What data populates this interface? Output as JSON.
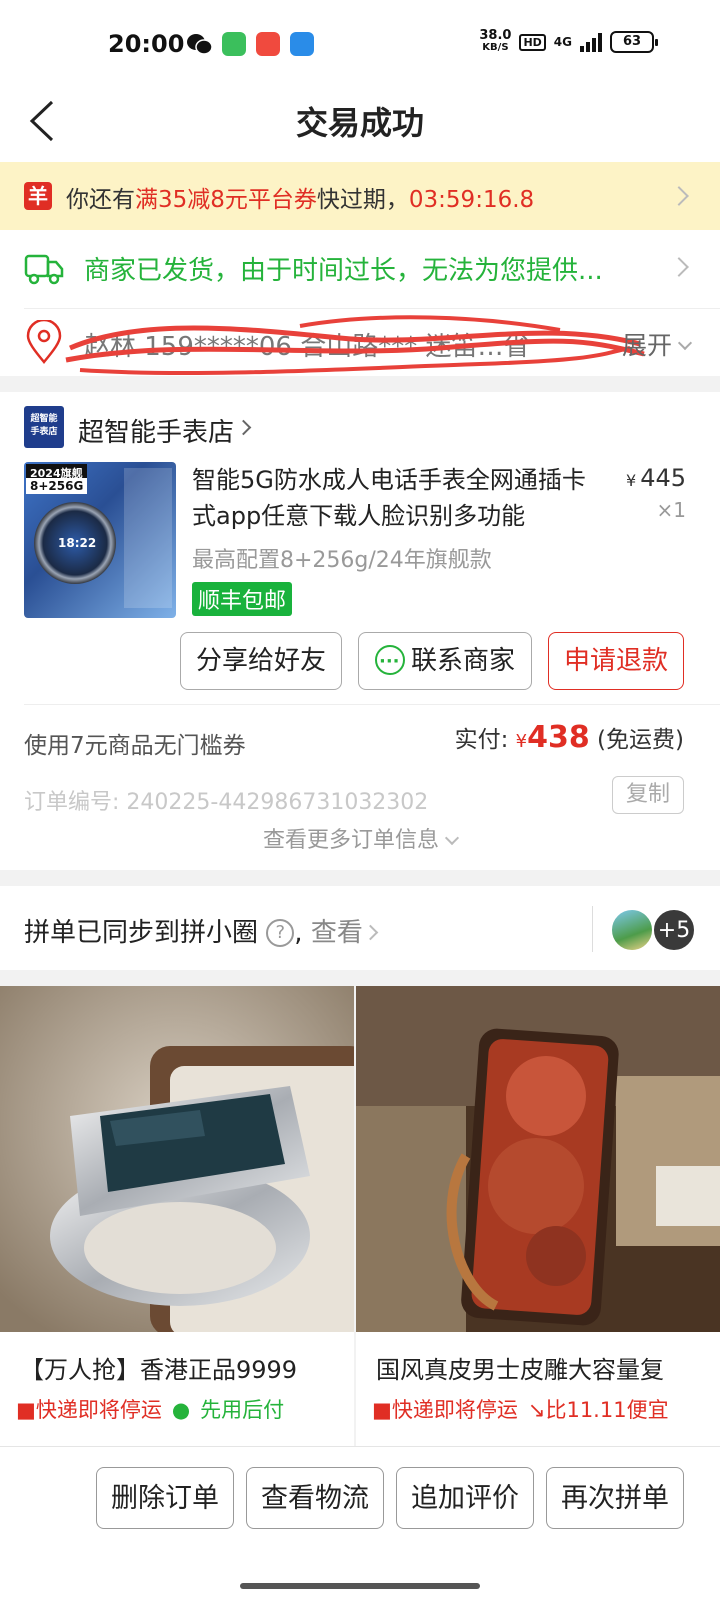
{
  "status_bar": {
    "time": "20:00",
    "net_speed": "38.0",
    "net_unit": "KB/S",
    "hd": "HD",
    "network": "4G",
    "battery": "63"
  },
  "nav": {
    "title": "交易成功"
  },
  "coupon_banner": {
    "icon_text": "羊",
    "prefix": "你还有",
    "highlight": "满35减8元平台券",
    "suffix": "快过期，",
    "countdown": "03:59:16.8"
  },
  "shipping": {
    "text": "商家已发货，由于时间过长，无法为您提供..."
  },
  "address": {
    "text": "赵林 159*****06 合山路*** 迷笛…省",
    "expand": "展开"
  },
  "shop": {
    "logo_line1": "超智能",
    "logo_line2": "手表店",
    "name": "超智能手表店"
  },
  "product": {
    "image_tag1": "2024旗舰",
    "image_tag2": "8+256G",
    "image_time": "18:22",
    "title": "智能5G防水成人电话手表全网通插卡式app任意下载人脸识别多功能",
    "price_symbol": "¥",
    "price": "445",
    "quantity": "×1",
    "spec": "最高配置8+256g/24年旗舰款",
    "badge": "顺丰包邮"
  },
  "actions": {
    "share": "分享给好友",
    "contact": "联系商家",
    "refund": "申请退款"
  },
  "payment": {
    "coupon_used": "使用7元商品无门槛券",
    "paid_label": "实付:",
    "currency": "¥",
    "amount": "438",
    "shipping_note": "(免运费)"
  },
  "order": {
    "number_label": "订单编号:",
    "number": "240225-442986731032302",
    "copy": "复制",
    "more": "查看更多订单信息"
  },
  "sync": {
    "text": "拼单已同步到拼小圈",
    "help": "?",
    "comma": ",",
    "view": "查看",
    "avatar_more": "+5"
  },
  "recommendations": [
    {
      "title": "【万人抢】香港正品9999",
      "tag1": "快递即将停运",
      "tag2": "先用后付"
    },
    {
      "title": "国风真皮男士皮雕大容量复",
      "tag1": "快递即将停运",
      "tag2": "比11.11便宜"
    }
  ],
  "bottom_buttons": {
    "delete": "删除订单",
    "logistics": "查看物流",
    "review": "追加评价",
    "regroup": "再次拼单"
  },
  "colors": {
    "accent_red": "#e02e24",
    "success_green": "#25b33b",
    "banner_yellow": "#fdf3c6"
  }
}
